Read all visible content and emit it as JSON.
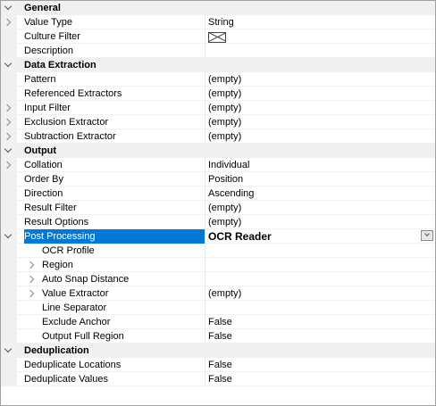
{
  "categories": {
    "general": "General",
    "data_extraction": "Data Extraction",
    "output": "Output",
    "deduplication": "Deduplication"
  },
  "general": {
    "value_type": {
      "name": "Value Type",
      "value": "String"
    },
    "culture_filter": {
      "name": "Culture Filter"
    },
    "description": {
      "name": "Description",
      "value": ""
    }
  },
  "data_extraction": {
    "pattern": {
      "name": "Pattern",
      "value": "(empty)"
    },
    "referenced_extractors": {
      "name": "Referenced Extractors",
      "value": "(empty)"
    },
    "input_filter": {
      "name": "Input Filter",
      "value": "(empty)"
    },
    "exclusion_extractor": {
      "name": "Exclusion Extractor",
      "value": "(empty)"
    },
    "subtraction_extractor": {
      "name": "Subtraction Extractor",
      "value": "(empty)"
    }
  },
  "output": {
    "collation": {
      "name": "Collation",
      "value": "Individual"
    },
    "order_by": {
      "name": "Order By",
      "value": "Position"
    },
    "direction": {
      "name": "Direction",
      "value": "Ascending"
    },
    "result_filter": {
      "name": "Result Filter",
      "value": "(empty)"
    },
    "result_options": {
      "name": "Result Options",
      "value": "(empty)"
    },
    "post_processing": {
      "name": "Post Processing",
      "value": "OCR Reader"
    },
    "ocr_profile": {
      "name": "OCR Profile",
      "value": ""
    },
    "region": {
      "name": "Region",
      "value": ""
    },
    "auto_snap_distance": {
      "name": "Auto Snap Distance",
      "value": ""
    },
    "value_extractor": {
      "name": "Value Extractor",
      "value": "(empty)"
    },
    "line_separator": {
      "name": "Line Separator",
      "value": ""
    },
    "exclude_anchor": {
      "name": "Exclude Anchor",
      "value": "False"
    },
    "output_full_region": {
      "name": "Output Full Region",
      "value": "False"
    }
  },
  "deduplication": {
    "deduplicate_locations": {
      "name": "Deduplicate Locations",
      "value": "False"
    },
    "deduplicate_values": {
      "name": "Deduplicate Values",
      "value": "False"
    }
  },
  "colors": {
    "selection": "#0078d7",
    "category_bg": "#f0f0f0"
  }
}
